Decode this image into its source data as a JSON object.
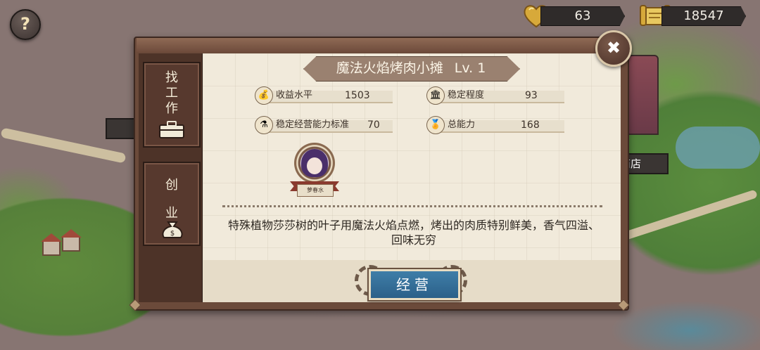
{
  "hud": {
    "help_label": "?",
    "hearts": "63",
    "coins": "18547"
  },
  "map": {
    "building_label": "商店"
  },
  "dialog": {
    "title": "魔法火焰烤肉小摊",
    "level": "Lv.  1",
    "stats": {
      "income_label": "收益水平",
      "income_value": "1503",
      "stability_label": "稳定程度",
      "stability_value": "93",
      "standard_label": "稳定经营能力标准",
      "standard_value": "70",
      "total_label": "总能力",
      "total_value": "168"
    },
    "character_name": "萝春水",
    "description": "特殊植物莎莎树的叶子用魔法火焰点燃，烤出的肉质特别鲜美，香气四溢、回味无穷",
    "manage_button": "经营",
    "close_label": "✖"
  },
  "sidebar": {
    "find_job": "找工作",
    "start_business": "创业"
  }
}
